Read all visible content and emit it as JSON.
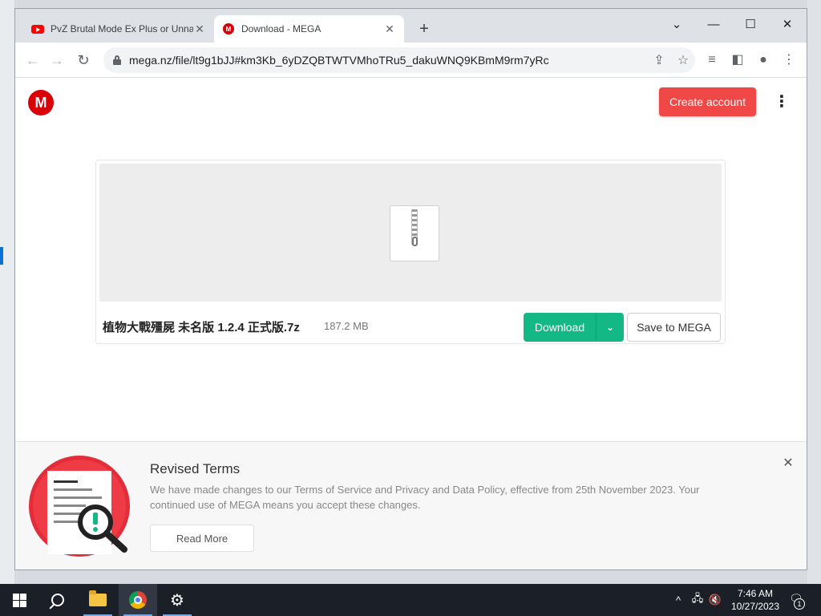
{
  "browser": {
    "tabs": [
      {
        "title": "PvZ Brutal Mode Ex Plus or Unnamed",
        "favicon": "youtube-icon",
        "active": false
      },
      {
        "title": "Download - MEGA",
        "favicon": "mega-icon",
        "active": true
      }
    ],
    "new_tab": "+",
    "window_controls": {
      "minimize": "—",
      "maximize": "☐",
      "close": "✕",
      "tab_search": "⌄"
    },
    "url": "mega.nz/file/lt9g1bJJ#km3Kb_6yDZQBTWTVMhoTRu5_dakuWNQ9KBmM9rm7yRc"
  },
  "page": {
    "logo": "M",
    "create_account": "Create account",
    "file": {
      "name": "植物大戰殭屍 未名版 1.2.4 正式版.7z",
      "size": "187.2 MB",
      "download_label": "Download",
      "save_label": "Save to MEGA"
    },
    "terms": {
      "title": "Revised Terms",
      "body": "We have made changes to our Terms of Service and Privacy and Data Policy, effective from 25th November 2023. Your continued use of MEGA means you accept these changes.",
      "read_more": "Read More"
    }
  },
  "taskbar": {
    "time": "7:46 AM",
    "date": "10/27/2023",
    "notifications": "1"
  },
  "colors": {
    "mega_red": "#d90007",
    "create_account_bg": "#f04747",
    "download_green": "#13b884",
    "taskbar_bg": "#1b2028"
  }
}
